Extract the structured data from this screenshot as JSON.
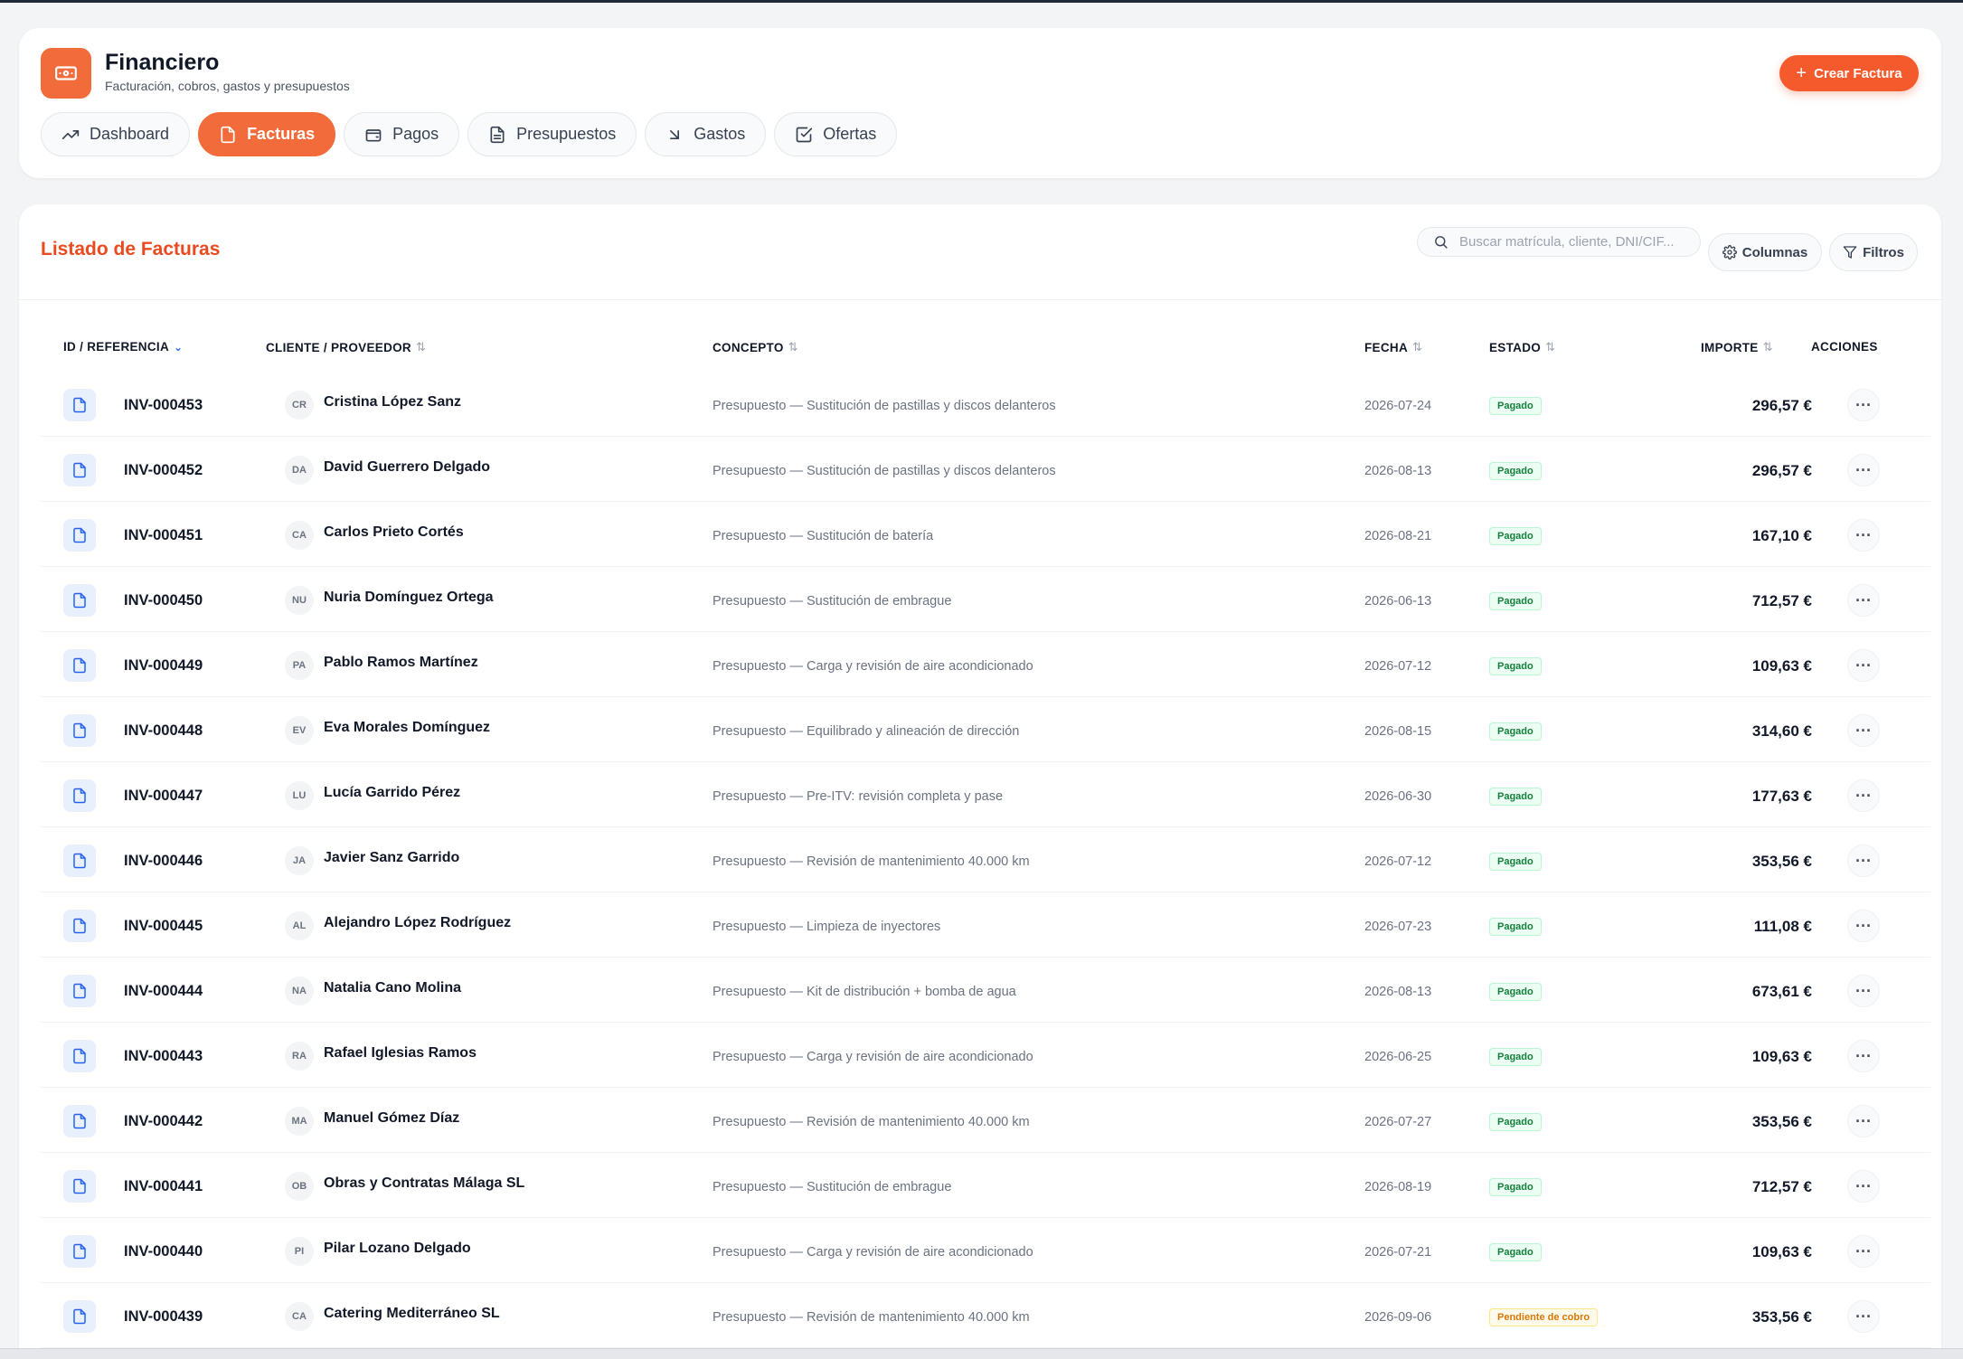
{
  "header": {
    "title": "Financiero",
    "subtitle": "Facturación, cobros, gastos y presupuestos",
    "create_button": "Crear Factura",
    "icon": "banknote-icon"
  },
  "tabs": [
    {
      "label": "Dashboard",
      "icon": "trending-up-icon",
      "active": false
    },
    {
      "label": "Facturas",
      "icon": "file-icon",
      "active": true
    },
    {
      "label": "Pagos",
      "icon": "wallet-icon",
      "active": false
    },
    {
      "label": "Presupuestos",
      "icon": "document-icon",
      "active": false
    },
    {
      "label": "Gastos",
      "icon": "arrow-down-right-icon",
      "active": false
    },
    {
      "label": "Ofertas",
      "icon": "check-square-icon",
      "active": false
    }
  ],
  "list": {
    "title": "Listado de Facturas",
    "search_placeholder": "Buscar matrícula, cliente, DNI/CIF...",
    "columns_button": "Columnas",
    "filters_button": "Filtros"
  },
  "table": {
    "headers": {
      "id": "ID / REFERENCIA",
      "client": "CLIENTE / PROVEEDOR",
      "concept": "CONCEPTO",
      "date": "FECHA",
      "status": "ESTADO",
      "amount": "IMPORTE",
      "actions": "ACCIONES"
    },
    "rows": [
      {
        "ref": "INV-000453",
        "initials": "CR",
        "client": "Cristina López Sanz",
        "concept": "Presupuesto — Sustitución de pastillas y discos delanteros",
        "date": "2026-07-24",
        "status": "Pagado",
        "amount": "296,57 €"
      },
      {
        "ref": "INV-000452",
        "initials": "DA",
        "client": "David Guerrero Delgado",
        "concept": "Presupuesto — Sustitución de pastillas y discos delanteros",
        "date": "2026-08-13",
        "status": "Pagado",
        "amount": "296,57 €"
      },
      {
        "ref": "INV-000451",
        "initials": "CA",
        "client": "Carlos Prieto Cortés",
        "concept": "Presupuesto — Sustitución de batería",
        "date": "2026-08-21",
        "status": "Pagado",
        "amount": "167,10 €"
      },
      {
        "ref": "INV-000450",
        "initials": "NU",
        "client": "Nuria Domínguez Ortega",
        "concept": "Presupuesto — Sustitución de embrague",
        "date": "2026-06-13",
        "status": "Pagado",
        "amount": "712,57 €"
      },
      {
        "ref": "INV-000449",
        "initials": "PA",
        "client": "Pablo Ramos Martínez",
        "concept": "Presupuesto — Carga y revisión de aire acondicionado",
        "date": "2026-07-12",
        "status": "Pagado",
        "amount": "109,63 €"
      },
      {
        "ref": "INV-000448",
        "initials": "EV",
        "client": "Eva Morales Domínguez",
        "concept": "Presupuesto — Equilibrado y alineación de dirección",
        "date": "2026-08-15",
        "status": "Pagado",
        "amount": "314,60 €"
      },
      {
        "ref": "INV-000447",
        "initials": "LU",
        "client": "Lucía Garrido Pérez",
        "concept": "Presupuesto — Pre-ITV: revisión completa y pase",
        "date": "2026-06-30",
        "status": "Pagado",
        "amount": "177,63 €"
      },
      {
        "ref": "INV-000446",
        "initials": "JA",
        "client": "Javier Sanz Garrido",
        "concept": "Presupuesto — Revisión de mantenimiento 40.000 km",
        "date": "2026-07-12",
        "status": "Pagado",
        "amount": "353,56 €"
      },
      {
        "ref": "INV-000445",
        "initials": "AL",
        "client": "Alejandro López Rodríguez",
        "concept": "Presupuesto — Limpieza de inyectores",
        "date": "2026-07-23",
        "status": "Pagado",
        "amount": "111,08 €"
      },
      {
        "ref": "INV-000444",
        "initials": "NA",
        "client": "Natalia Cano Molina",
        "concept": "Presupuesto — Kit de distribución + bomba de agua",
        "date": "2026-08-13",
        "status": "Pagado",
        "amount": "673,61 €"
      },
      {
        "ref": "INV-000443",
        "initials": "RA",
        "client": "Rafael Iglesias Ramos",
        "concept": "Presupuesto — Carga y revisión de aire acondicionado",
        "date": "2026-06-25",
        "status": "Pagado",
        "amount": "109,63 €"
      },
      {
        "ref": "INV-000442",
        "initials": "MA",
        "client": "Manuel Gómez Díaz",
        "concept": "Presupuesto — Revisión de mantenimiento 40.000 km",
        "date": "2026-07-27",
        "status": "Pagado",
        "amount": "353,56 €"
      },
      {
        "ref": "INV-000441",
        "initials": "OB",
        "client": "Obras y Contratas Málaga SL",
        "concept": "Presupuesto — Sustitución de embrague",
        "date": "2026-08-19",
        "status": "Pagado",
        "amount": "712,57 €"
      },
      {
        "ref": "INV-000440",
        "initials": "PI",
        "client": "Pilar Lozano Delgado",
        "concept": "Presupuesto — Carga y revisión de aire acondicionado",
        "date": "2026-07-21",
        "status": "Pagado",
        "amount": "109,63 €"
      },
      {
        "ref": "INV-000439",
        "initials": "CA",
        "client": "Catering Mediterráneo SL",
        "concept": "Presupuesto — Revisión de mantenimiento 40.000 km",
        "date": "2026-09-06",
        "status": "Pendiente de cobro",
        "amount": "353,56 €"
      }
    ]
  },
  "colors": {
    "accent": "#f26b3a",
    "title_accent": "#ea4a1f",
    "paid": "#15803d",
    "pending": "#d97706"
  }
}
